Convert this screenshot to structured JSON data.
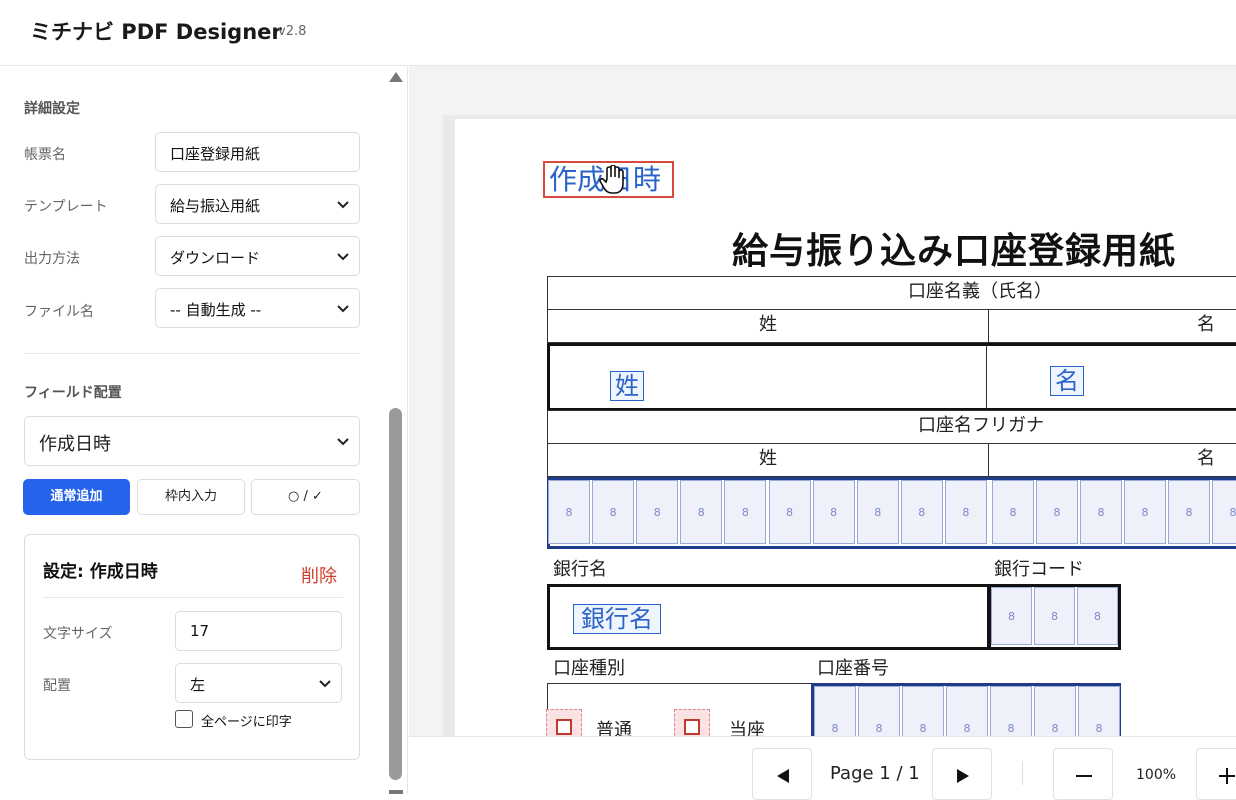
{
  "app": {
    "title": "ミチナビ PDF Designer",
    "version": "v2.8"
  },
  "sidebar": {
    "detail_section": "詳細設定",
    "fields": [
      {
        "label": "帳票名",
        "value": "口座登録用紙"
      },
      {
        "label": "テンプレート",
        "value": "給与振込用紙"
      },
      {
        "label": "出力方法",
        "value": "ダウンロード"
      },
      {
        "label": "ファイル名",
        "value": "-- 自動生成 --"
      }
    ],
    "field_section": "フィールド配置",
    "selected_field": "作成日時",
    "tabs": [
      {
        "label": "通常追加",
        "active": true
      },
      {
        "label": "枠内入力",
        "active": false
      },
      {
        "label": "○ / ✓",
        "active": false
      }
    ],
    "settings": {
      "title": "設定: 作成日時",
      "delete": "削除",
      "font_size_label": "文字サイズ",
      "font_size": "17",
      "align_label": "配置",
      "align": "左",
      "all_pages_label": "全ページに印字",
      "all_pages": false
    }
  },
  "document": {
    "created_field": "作成日時",
    "title": "給与振り込み口座登録用紙",
    "account_holder": "口座名義（氏名）",
    "surname": "姓",
    "given_name": "名",
    "surname_field": "姓",
    "given_name_field": "名",
    "furigana": "口座名フリガナ",
    "furigana_surname": "姓",
    "furigana_given": "名",
    "cell_digit": "8",
    "bank_name_label": "銀行名",
    "bank_code_label": "銀行コード",
    "bank_name_field": "銀行名",
    "account_type_label": "口座種別",
    "account_number_label": "口座番号",
    "type_options": [
      "普通",
      "当座"
    ]
  },
  "pagination": {
    "page": "Page 1 / 1",
    "zoom": "100%"
  },
  "colors": {
    "accent": "#2563eb",
    "field": "#2a64c8",
    "delete": "#d43b2a",
    "selected": "#d94a3e"
  }
}
